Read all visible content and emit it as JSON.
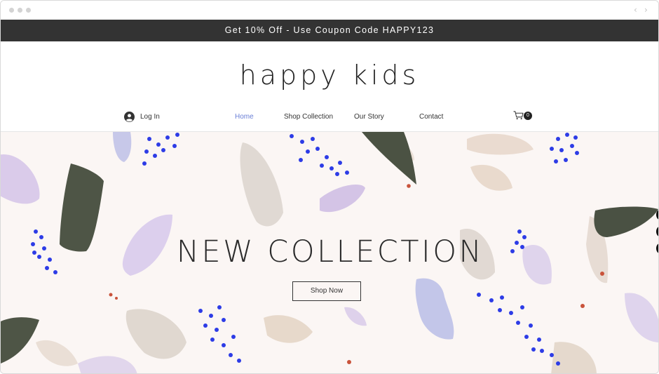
{
  "promo": {
    "text": "Get 10% Off - Use Coupon Code HAPPY123"
  },
  "site": {
    "title": "happy kids"
  },
  "header": {
    "login_label": "Log In",
    "menu": [
      {
        "label": "Home",
        "active": true
      },
      {
        "label": "Shop Collection",
        "active": false
      },
      {
        "label": "Our Story",
        "active": false
      },
      {
        "label": "Contact",
        "active": false
      }
    ],
    "cart_count": "0"
  },
  "hero": {
    "title": "NEW COLLECTION",
    "button_label": "Shop Now"
  },
  "colors": {
    "promo_bg": "#333333",
    "active_link": "#6a7fd6",
    "hero_bg": "#fbf6f4",
    "stroke_olive": "#4e5546",
    "stroke_lilac": "#cdbbe3",
    "stroke_beige": "#ddd2c8",
    "stroke_periwinkle": "#b9bde6",
    "dots_blue": "#2d3ce6",
    "dots_red": "#c9533b"
  },
  "icons": {
    "login": "user-avatar-icon",
    "cart": "shopping-cart-icon",
    "back": "chevron-left-icon",
    "forward": "chevron-right-icon"
  }
}
